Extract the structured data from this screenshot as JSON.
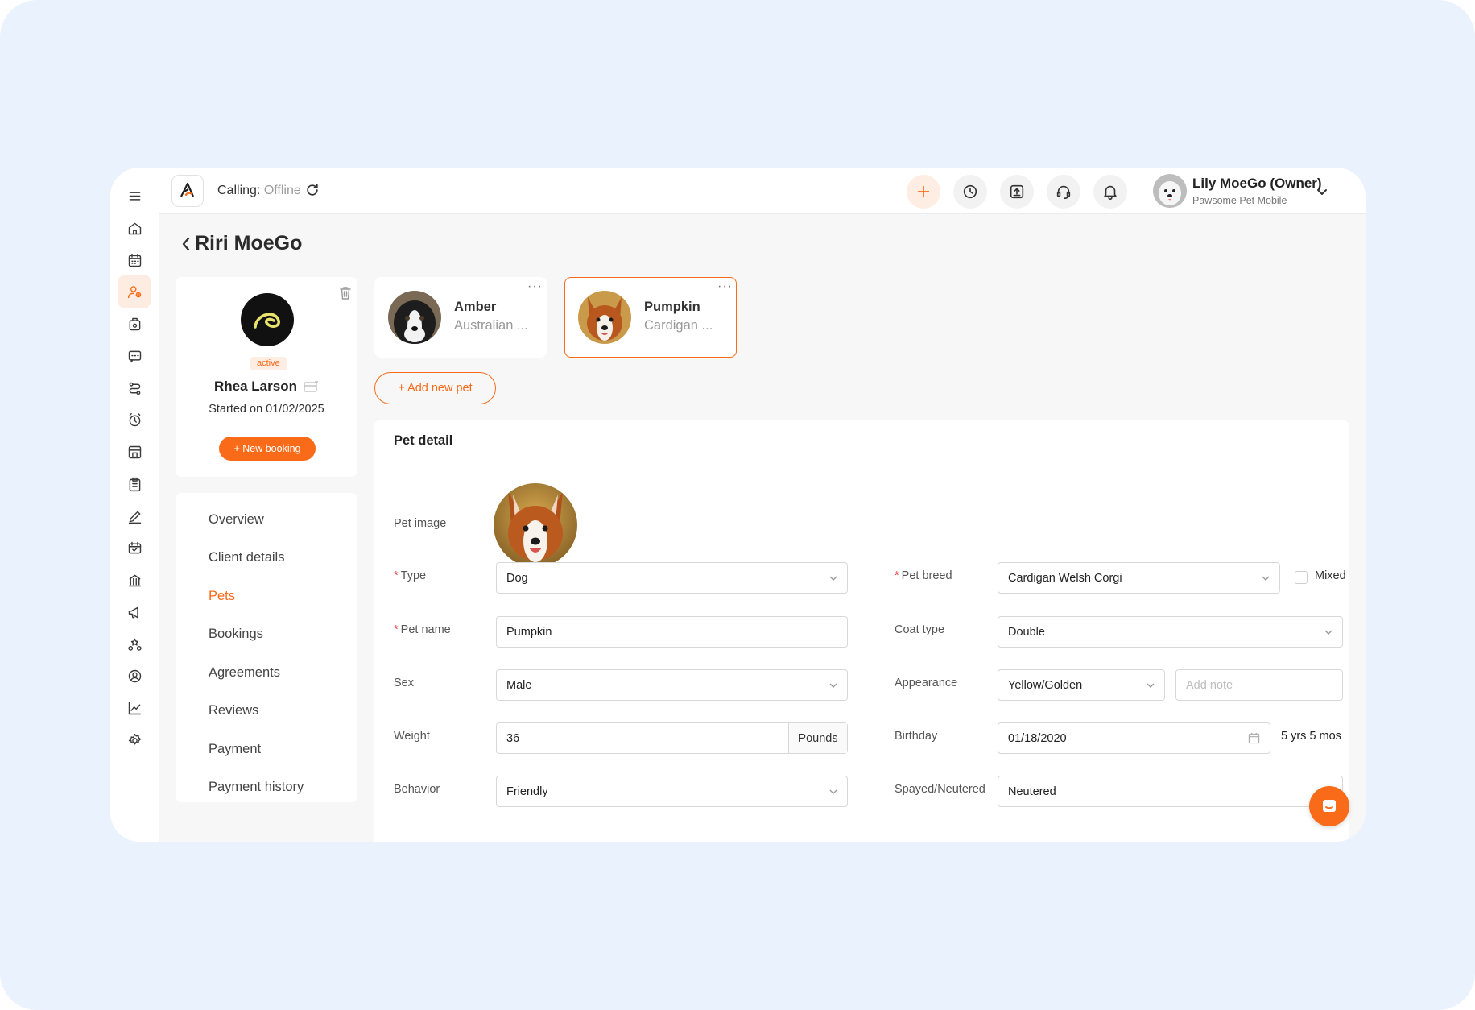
{
  "colors": {
    "accent": "#F96B18",
    "backdrop": "#EAF2FD",
    "app_bg": "#F7F7F7"
  },
  "topbar": {
    "calling_label": "Calling:",
    "calling_status": "Offline",
    "user": {
      "name": "Lily MoeGo (Owner)",
      "business": "Pawsome Pet Mobile"
    },
    "actions": [
      "plus-icon",
      "clock-icon",
      "upload-icon",
      "headset-icon",
      "bell-icon"
    ]
  },
  "sidebar": {
    "items": [
      "menu-icon",
      "home-icon",
      "calendar-icon",
      "clients-icon",
      "pets-bag-icon",
      "message-icon",
      "route-icon",
      "alarm-icon",
      "grooming-icon",
      "clipboard-icon",
      "edit-icon",
      "ticket-icon",
      "building-icon",
      "megaphone-icon",
      "awards-icon",
      "user-circle-icon",
      "chart-icon",
      "settings-icon"
    ],
    "active": "clients-icon"
  },
  "page": {
    "title": "Riri MoeGo"
  },
  "client": {
    "status": "active",
    "name": "Rhea Larson",
    "started": "Started on 01/02/2025",
    "new_booking": "+ New booking"
  },
  "client_nav": {
    "items": [
      "Overview",
      "Client details",
      "Pets",
      "Bookings",
      "Agreements",
      "Reviews",
      "Payment",
      "Payment history"
    ],
    "active": "Pets"
  },
  "pets": [
    {
      "name": "Amber",
      "breed": "Australian ...",
      "selected": false
    },
    {
      "name": "Pumpkin",
      "breed": "Cardigan ...",
      "selected": true
    }
  ],
  "pet_more": "···",
  "add_pet": "+ Add new pet",
  "detail": {
    "title": "Pet detail",
    "labels": {
      "image": "Pet image",
      "type": "Type",
      "pet_name": "Pet name",
      "sex": "Sex",
      "weight": "Weight",
      "behavior": "Behavior",
      "breed": "Pet breed",
      "coat": "Coat type",
      "appearance": "Appearance",
      "birthday": "Birthday",
      "spayed": "Spayed/Neutered",
      "mixed": "Mixed"
    },
    "values": {
      "type": "Dog",
      "pet_name": "Pumpkin",
      "sex": "Male",
      "weight": "36",
      "weight_unit": "Pounds",
      "behavior": "Friendly",
      "breed": "Cardigan Welsh Corgi",
      "coat": "Double",
      "appearance": "Yellow/Golden",
      "birthday": "01/18/2020",
      "age": "5 yrs 5 mos",
      "spayed": "Neutered"
    },
    "placeholders": {
      "appearance_note": "Add note"
    },
    "required_mark": "*"
  }
}
